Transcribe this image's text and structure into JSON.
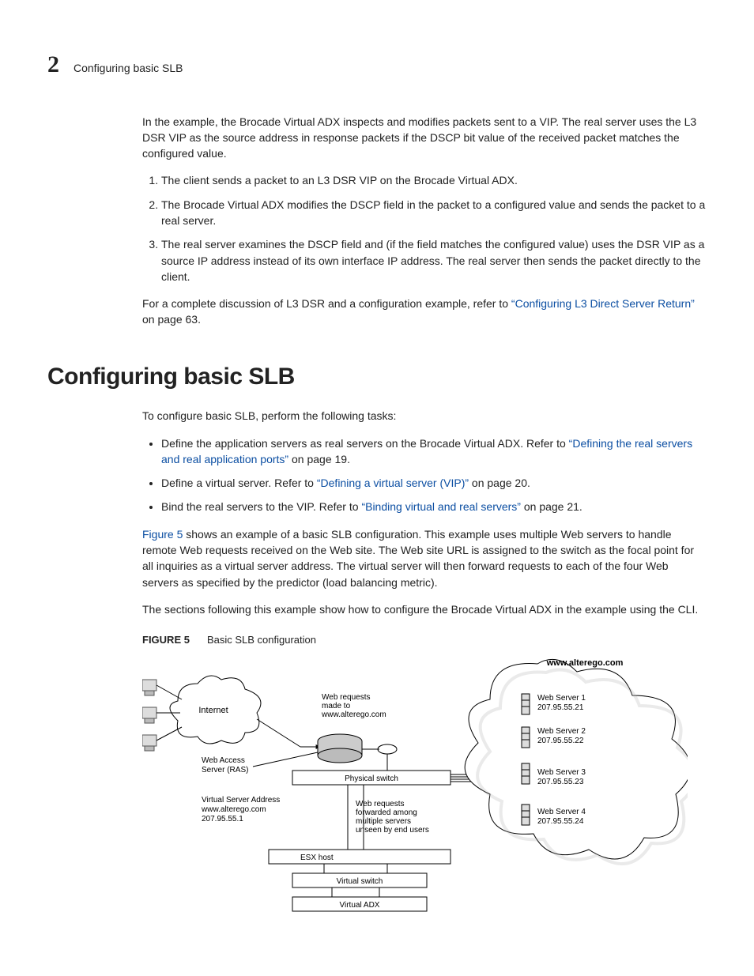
{
  "header": {
    "chapter_number": "2",
    "running_head": "Configuring basic SLB"
  },
  "intro_para": "In the example, the Brocade Virtual ADX inspects and modifies packets sent to a VIP. The real server uses the L3 DSR VIP as the source address in response packets if the DSCP bit value of the received packet matches the configured value.",
  "steps": [
    "The client sends a packet to an L3 DSR VIP on the Brocade Virtual ADX.",
    "The Brocade Virtual ADX modifies the DSCP field in the packet to a configured value and sends the packet to a real server.",
    "The real server examines the DSCP field and (if the field matches the configured value) uses the DSR VIP as a source IP address instead of its own interface IP address. The real server then sends the packet directly to the client."
  ],
  "ref_para_pre": "For a complete discussion of L3 DSR and a configuration example, refer to ",
  "ref_link": "“Configuring L3 Direct Server Return”",
  "ref_para_post": " on page 63.",
  "section_heading": "Configuring basic SLB",
  "tasks_intro": "To configure basic SLB, perform the following tasks:",
  "bullets": [
    {
      "pre": "Define the application servers as real servers on the Brocade Virtual ADX. Refer to ",
      "link": "“Defining the real servers and real application ports”",
      "post": " on page 19."
    },
    {
      "pre": "Define a virtual server. Refer to ",
      "link": "“Defining a virtual server (VIP)”",
      "post": " on page 20."
    },
    {
      "pre": "Bind the real servers to the VIP. Refer to ",
      "link": "“Binding virtual and real servers”",
      "post": " on page 21."
    }
  ],
  "fig_ref": {
    "link": "Figure 5",
    "post": " shows an example of a basic SLB configuration. This example uses multiple Web servers to handle remote Web requests received on the Web site. The Web site URL is assigned to the switch as the focal point for all inquiries as a virtual server address. The virtual server will then forward requests to each of the four Web servers as specified by the predictor (load balancing metric)."
  },
  "cli_para": "The sections following this example show how to configure the Brocade Virtual ADX in the example using the CLI.",
  "figure": {
    "label": "FIGURE 5",
    "title": "Basic SLB configuration",
    "labels": {
      "domain": "www.alterego.com",
      "internet": "Internet",
      "web_reqs_to": "Web requests\nmade to\nwww.alterego.com",
      "ras": "Web Access\nServer (RAS)",
      "phys_switch": "Physical switch",
      "vip": "Virtual Server Address\nwww.alterego.com\n207.95.55.1",
      "fwd": "Web requests\nforwarded among\nmultiple servers\nunseen by end users",
      "esx": "ESX host",
      "vswitch": "Virtual switch",
      "vadx": "Virtual ADX",
      "servers": [
        {
          "name": "Web Server 1",
          "ip": "207.95.55.21"
        },
        {
          "name": "Web Server 2",
          "ip": "207.95.55.22"
        },
        {
          "name": "Web Server 3",
          "ip": "207.95.55.23"
        },
        {
          "name": "Web Server 4",
          "ip": "207.95.55.24"
        }
      ]
    }
  }
}
